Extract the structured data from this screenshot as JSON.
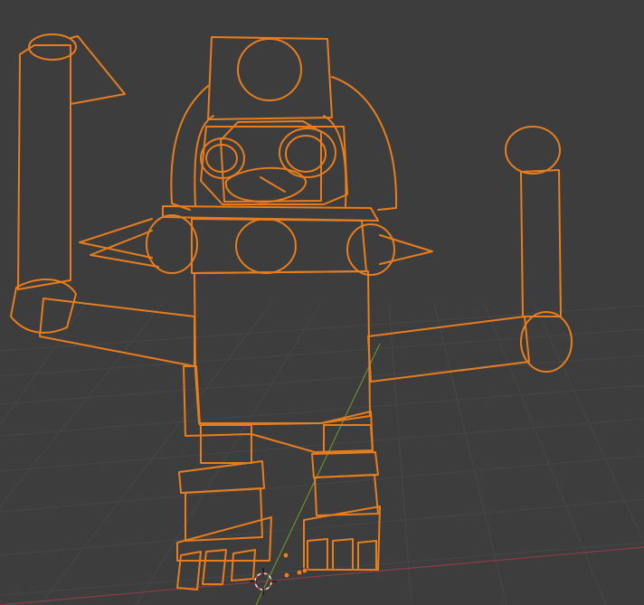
{
  "viewport": {
    "background_color": "#3d3d3d",
    "grid_color": "#474747",
    "outline_color": "#e87d1e",
    "x_axis_color": "#8b3b4e",
    "y_axis_color": "#6b8f2b",
    "cursor_icon": "3d-cursor-icon",
    "origin_icon": "origin-dot-icon"
  }
}
